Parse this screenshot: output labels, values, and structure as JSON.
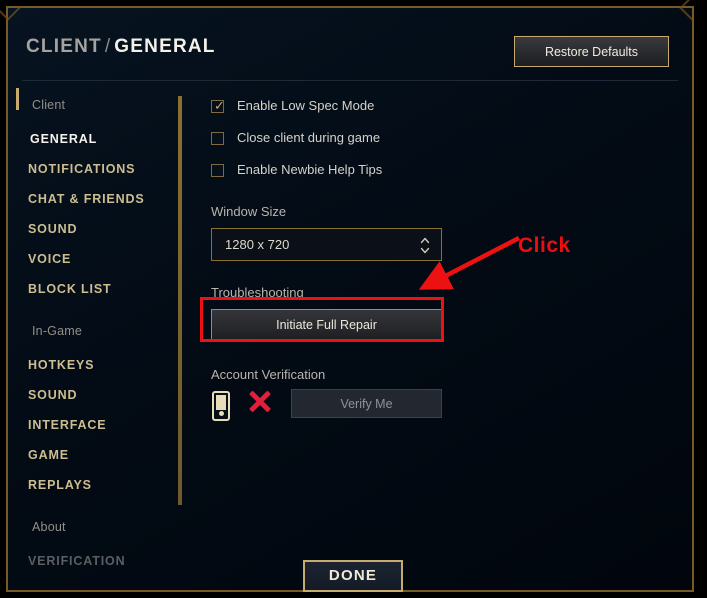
{
  "window": {
    "accent_gold": "#c8aa6e",
    "background": "#030b15",
    "annotation_red": "#ee1111"
  },
  "header": {
    "breadcrumb_root": "CLIENT",
    "breadcrumb_separator": "/",
    "breadcrumb_current": "GENERAL",
    "restore_defaults_label": "Restore Defaults"
  },
  "sidebar": {
    "groups": [
      {
        "label": "Client",
        "items": [
          {
            "label": "GENERAL",
            "active": true
          },
          {
            "label": "NOTIFICATIONS",
            "active": false
          },
          {
            "label": "CHAT & FRIENDS",
            "active": false
          },
          {
            "label": "SOUND",
            "active": false
          },
          {
            "label": "VOICE",
            "active": false
          },
          {
            "label": "BLOCK LIST",
            "active": false
          }
        ]
      },
      {
        "label": "In-Game",
        "items": [
          {
            "label": "HOTKEYS",
            "active": false
          },
          {
            "label": "SOUND",
            "active": false
          },
          {
            "label": "INTERFACE",
            "active": false
          },
          {
            "label": "GAME",
            "active": false
          },
          {
            "label": "REPLAYS",
            "active": false
          }
        ]
      },
      {
        "label": "About",
        "items": [
          {
            "label": "VERIFICATION",
            "active": false,
            "muted": true
          }
        ]
      }
    ]
  },
  "content": {
    "checkboxes": [
      {
        "label": "Enable Low Spec Mode",
        "checked": true,
        "tick": "✓"
      },
      {
        "label": "Close client during game",
        "checked": false,
        "tick": ""
      },
      {
        "label": "Enable Newbie Help Tips",
        "checked": false,
        "tick": ""
      }
    ],
    "window_size": {
      "label": "Window Size",
      "value": "1280 x 720",
      "stepper_up": "▲",
      "stepper_down": "▼"
    },
    "troubleshooting": {
      "label": "Troubleshooting",
      "repair_button_label": "Initiate Full Repair"
    },
    "account_verification": {
      "label": "Account Verification",
      "phone_icon": "phone-icon",
      "status_icon": "x-mark-icon",
      "verify_button_label": "Verify Me"
    }
  },
  "footer": {
    "done_label": "DONE"
  },
  "annotations": {
    "click_label": "Click",
    "arrow": "arrow-pointing-down-left-icon",
    "highlight": "highlight-rectangle"
  }
}
